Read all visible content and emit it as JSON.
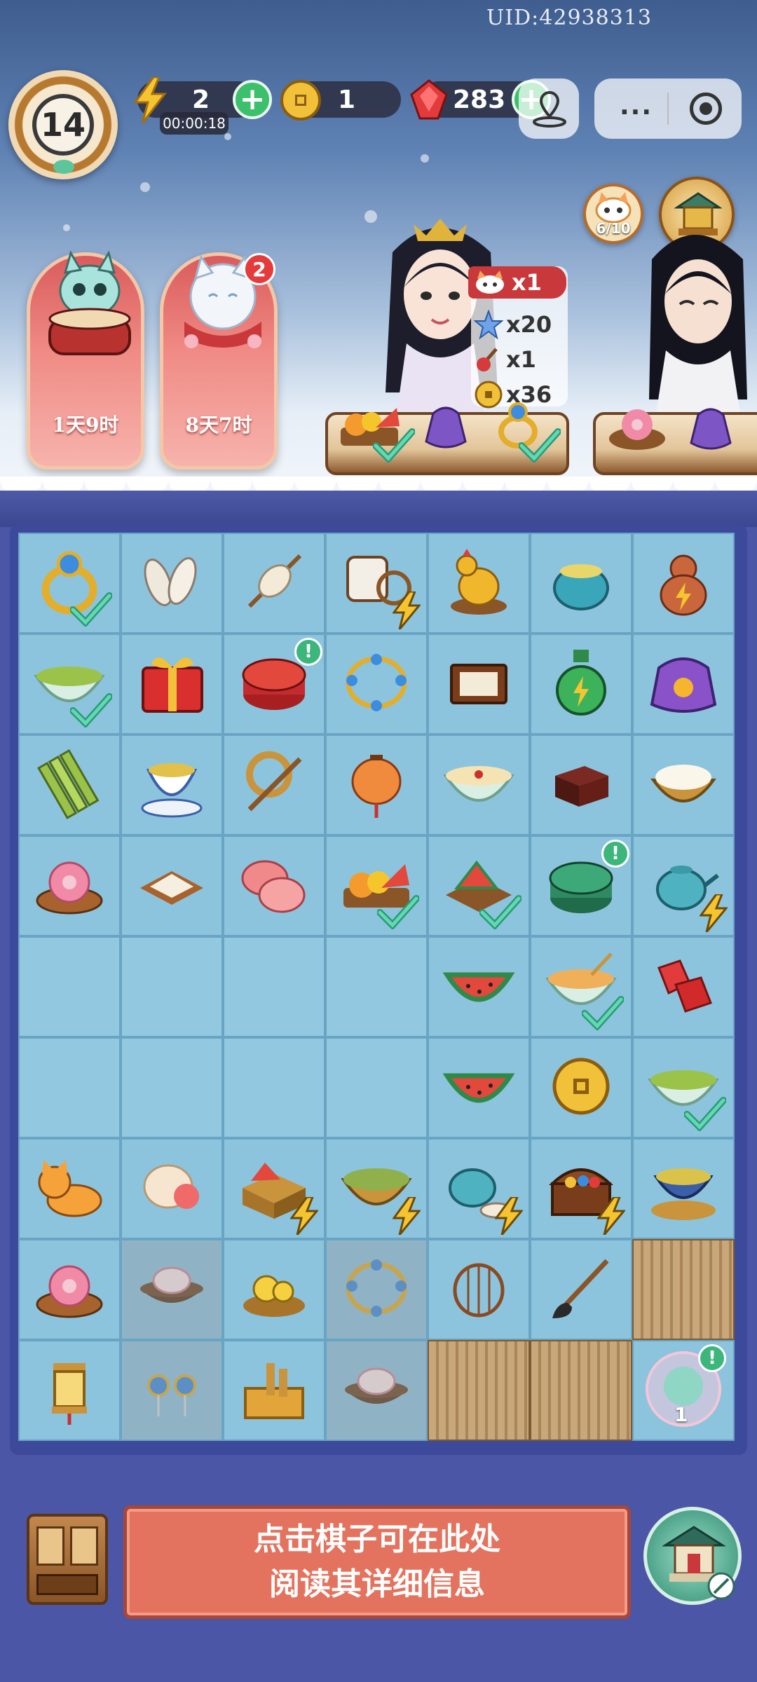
{
  "header": {
    "uid": "UID:42938313",
    "level": "14",
    "energy": {
      "value": "2",
      "timer": "00:00:18",
      "icon": "lightning-icon"
    },
    "coins": {
      "value": "1",
      "icon": "coin-icon"
    },
    "gems": {
      "value": "283",
      "icon": "ruby-gem-icon"
    }
  },
  "events": [
    {
      "name": "drum-cat-event",
      "time_left": "1天9时"
    },
    {
      "name": "white-cat-event",
      "time_left": "8天7时",
      "badge": "2"
    }
  ],
  "side_buttons": {
    "cat_collection": "6/10"
  },
  "order": {
    "cat_count": "x1",
    "rewards": [
      {
        "icon": "star-icon",
        "amount": "x20"
      },
      {
        "icon": "potion-icon",
        "amount": "x1"
      },
      {
        "icon": "coin-icon",
        "amount": "x36"
      }
    ]
  },
  "board": {
    "rows": 9,
    "cols": 7,
    "cells": [
      [
        "gold-ring",
        "silk-cocoons",
        "spindle",
        "silk-loom",
        "golden-rooster",
        "tea-jar",
        "energy-gourd"
      ],
      [
        "mung-bean-soup",
        "mystery-gift-box",
        "red-lacquer-box",
        "jade-bracelet",
        "wooden-tray",
        "energy-bottle",
        "embroidered-pouch"
      ],
      [
        "bamboo-slips",
        "tea-cup",
        "writing-brush-roll",
        "paper-lantern",
        "congee-bowl",
        "dark-box",
        "flour-basket"
      ],
      [
        "flower-cake",
        "rice-cake",
        "pink-mooncake",
        "fruit-platter",
        "watermelon-board",
        "green-lacquer-box",
        "teapot"
      ],
      [
        "",
        "",
        "",
        "",
        "watermelon-slice",
        "sweet-soup-bowl",
        "ruby-gems"
      ],
      [
        "",
        "",
        "",
        "",
        "watermelon-slice",
        "copper-coin",
        "mung-bean-soup"
      ],
      [
        "orange-cat",
        "rice-dumpling",
        "fruit-basket",
        "yarn-basket",
        "teapot-set",
        "treasure-chest",
        "tea-pot-stove"
      ],
      [
        "flower-cake",
        "bun-plate",
        "chick-nest",
        "jade-bracelet",
        "bird-cage",
        "writing-brush",
        "locked-crate"
      ],
      [
        "hanging-lantern",
        "earrings",
        "wooden-toolbox",
        "bun-plate",
        "locked-crate",
        "locked-crate",
        "jade-bubble"
      ]
    ],
    "bubble_count": "1"
  },
  "info_panel": {
    "line1": "点击棋子可在此处",
    "line2": "阅读其详细信息"
  }
}
